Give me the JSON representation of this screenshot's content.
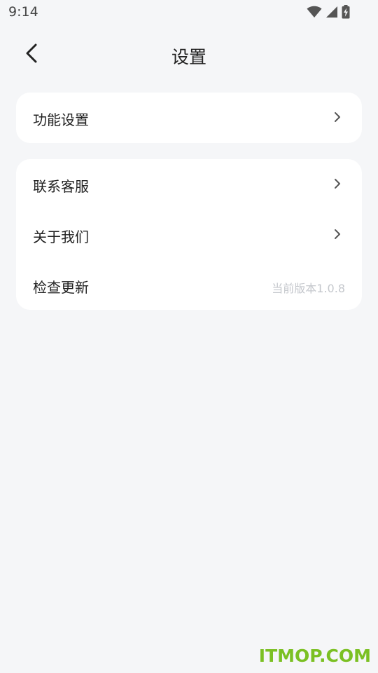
{
  "status_bar": {
    "time": "9:14",
    "icons": [
      "wifi-icon",
      "signal-icon",
      "battery-charging-icon"
    ]
  },
  "header": {
    "title": "设置",
    "back_icon": "chevron-left-icon"
  },
  "groups": [
    {
      "items": [
        {
          "label": "功能设置",
          "icon": "chevron-right-icon"
        }
      ]
    },
    {
      "items": [
        {
          "label": "联系客服",
          "icon": "chevron-right-icon"
        },
        {
          "label": "关于我们",
          "icon": "chevron-right-icon"
        },
        {
          "label": "检查更新",
          "value": "当前版本1.0.8"
        }
      ]
    }
  ],
  "watermark": "ITMOP.COM",
  "colors": {
    "background": "#f5f6f8",
    "card": "#ffffff",
    "text": "#222222",
    "muted": "#c4c7cc",
    "watermark": "#7bc023"
  }
}
